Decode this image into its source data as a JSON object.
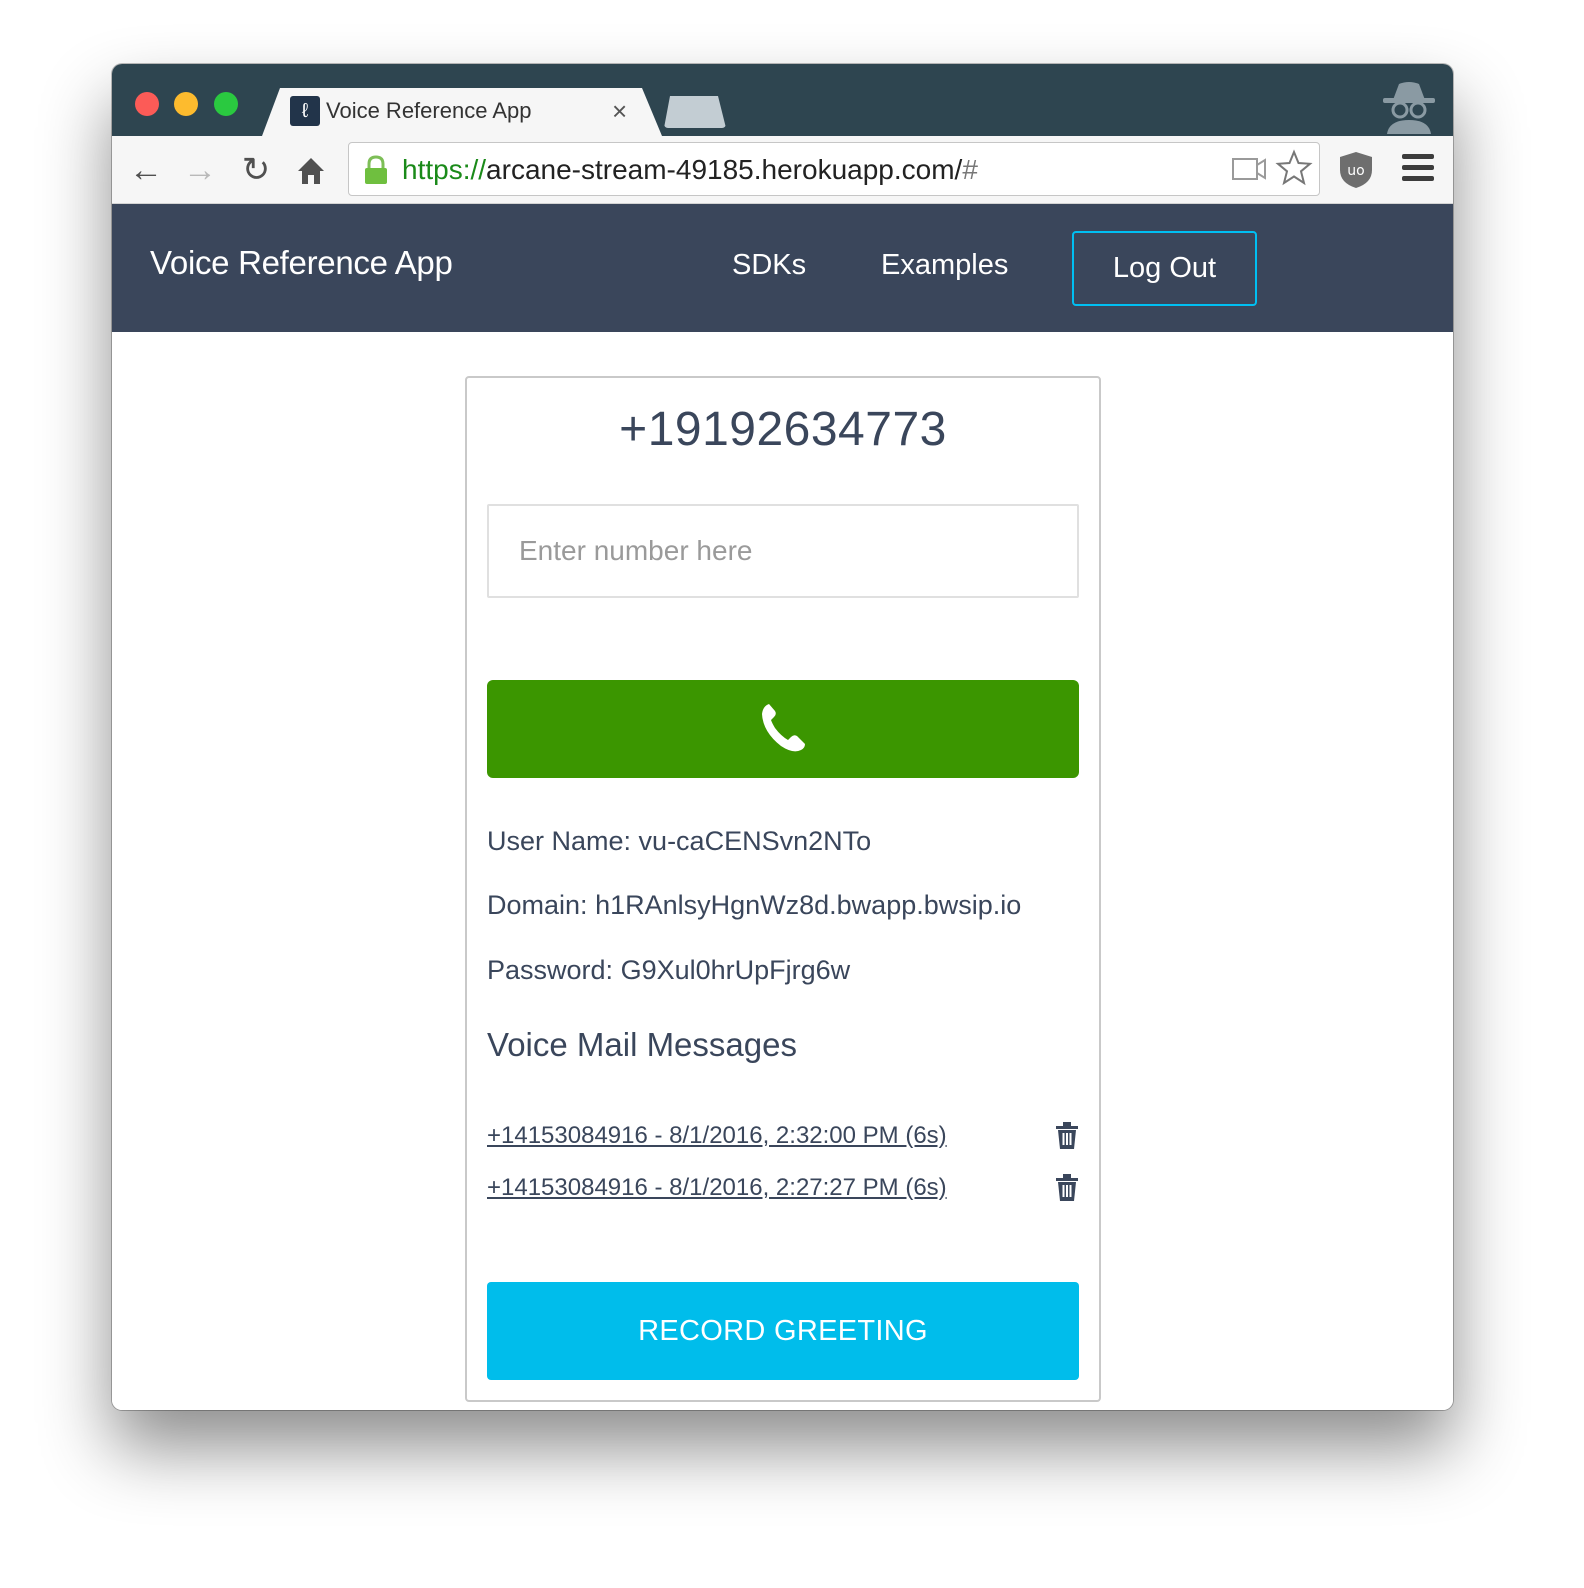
{
  "browser": {
    "tab_title": "Voice Reference App",
    "tab_favicon": "app-favicon",
    "url_scheme": "https://",
    "url_host": "arcane-stream-49185.herokuapp.com/",
    "url_hash": "#",
    "icons": [
      "back-icon",
      "forward-icon",
      "reload-icon",
      "home-icon",
      "lock-icon",
      "camera-icon",
      "star-icon",
      "ublock-icon",
      "menu-icon",
      "incognito-icon"
    ]
  },
  "nav": {
    "brand": "Voice Reference App",
    "links": [
      "SDKs",
      "Examples"
    ],
    "logout_label": "Log Out"
  },
  "card": {
    "phone_number": "+19192634773",
    "input_placeholder": "Enter number here",
    "call_icon": "phone-icon",
    "user_name_label": "User Name:",
    "user_name": "vu-caCENSvn2NTo",
    "domain_label": "Domain:",
    "domain": "h1RAnlsyHgnWz8d.bwapp.bwsip.io",
    "password_label": "Password:",
    "password": "G9Xul0hrUpFjrg6w",
    "voicemail_title": "Voice Mail Messages",
    "voicemails": [
      {
        "label": "+14153084916 - 8/1/2016, 2:32:00 PM (6s)"
      },
      {
        "label": "+14153084916 - 8/1/2016, 2:27:27 PM (6s)"
      }
    ],
    "record_label": "RECORD GREETING"
  },
  "colors": {
    "navbar": "#3a465b",
    "call_button": "#3b9600",
    "record_button": "#00bdeb",
    "logout_border": "#00bff2"
  }
}
